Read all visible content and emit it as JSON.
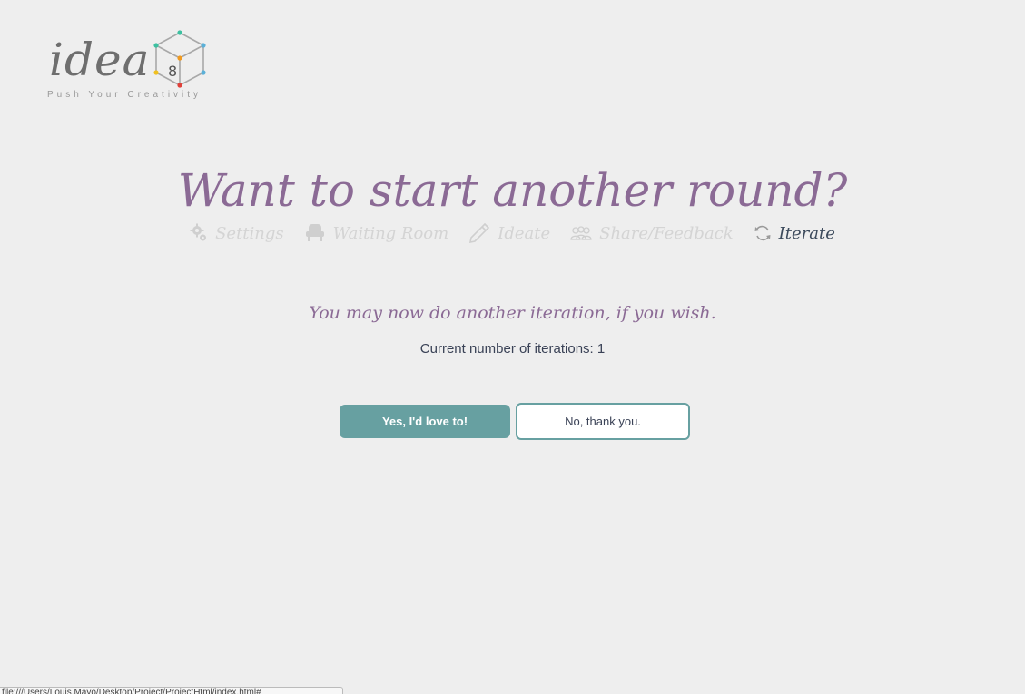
{
  "logo": {
    "word": "idea",
    "cube_number": "8",
    "tagline": "Push Your Creativity"
  },
  "heading": "Want to start another round?",
  "steps": [
    {
      "label": "Settings",
      "icon": "gear-icon",
      "active": false
    },
    {
      "label": "Waiting Room",
      "icon": "chair-icon",
      "active": false
    },
    {
      "label": "Ideate",
      "icon": "pencil-icon",
      "active": false
    },
    {
      "label": "Share/Feedback",
      "icon": "people-icon",
      "active": false
    },
    {
      "label": "Iterate",
      "icon": "refresh-icon",
      "active": true
    }
  ],
  "message": "You may now do another iteration, if you wish.",
  "iterations_text": "Current number of iterations: 1",
  "buttons": {
    "yes": "Yes, I'd love to!",
    "no": "No, thank you."
  },
  "status_bar": "file:///Users/Louis.Mayo/Desktop/Project/ProjectHtml/index.html#"
}
